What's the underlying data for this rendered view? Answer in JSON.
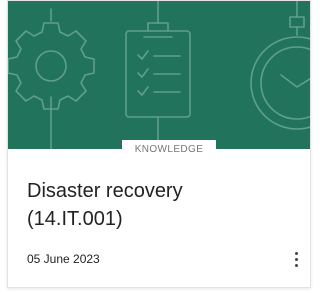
{
  "card": {
    "badge": "KNOWLEDGE",
    "title_line1": "Disaster recovery",
    "title_line2": "(14.IT.001)",
    "date": "05 June 2023",
    "banner_color": "#22735c",
    "banner_icons": [
      "gear-icon",
      "clipboard-checklist-icon",
      "stopwatch-icon"
    ],
    "more_icon": "more-vertical-icon"
  }
}
